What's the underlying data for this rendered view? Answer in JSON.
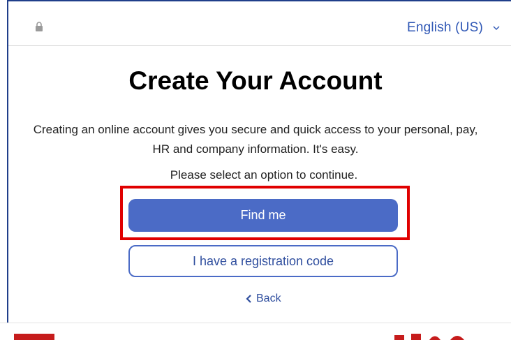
{
  "header": {
    "language": "English (US)",
    "lock_icon": "lock-icon",
    "dropdown_icon": "chevron-down-icon"
  },
  "main": {
    "title": "Create Your Account",
    "intro": "Creating an online account gives you secure and quick access to your personal, pay, HR and company information. It's easy.",
    "prompt": "Please select an option to continue.",
    "find_me_label": "Find me",
    "registration_code_label": "I have a registration code",
    "back_label": "Back",
    "back_icon": "chevron-left-icon"
  },
  "colors": {
    "primary": "#4b6bc6",
    "link": "#2f57b5",
    "highlight": "#e00000"
  }
}
